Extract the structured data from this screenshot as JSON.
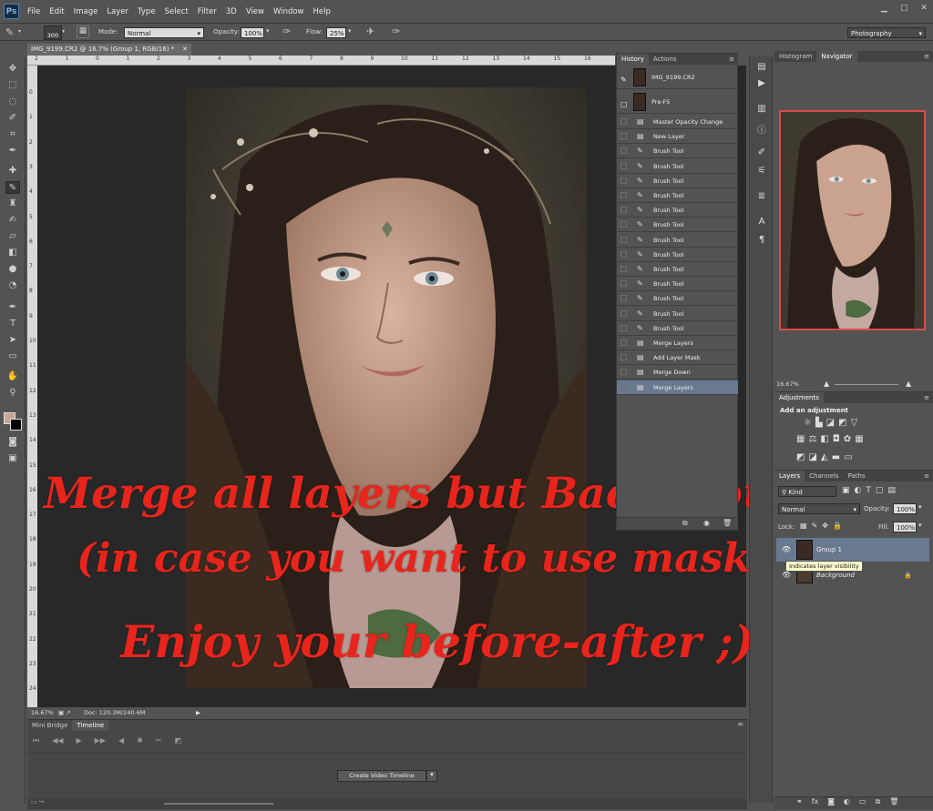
{
  "app": {
    "logo": "Ps"
  },
  "menu": [
    "File",
    "Edit",
    "Image",
    "Layer",
    "Type",
    "Select",
    "Filter",
    "3D",
    "View",
    "Window",
    "Help"
  ],
  "options": {
    "brush_size": "300",
    "mode_label": "Mode:",
    "mode_value": "Normal",
    "opacity_label": "Opacity:",
    "opacity_value": "100%",
    "flow_label": "Flow:",
    "flow_value": "25%",
    "workspace": "Photography"
  },
  "document": {
    "tab_title": "IMG_9199.CR2 @ 16.7% (Group 1, RGB/16) *",
    "ruler_numbers": [
      "2",
      "1",
      "0",
      "1",
      "2",
      "3",
      "4",
      "5",
      "6",
      "7",
      "8",
      "9",
      "10",
      "11",
      "12",
      "13",
      "14",
      "15",
      "16"
    ],
    "ruler_left_numbers": [
      "0",
      "1",
      "2",
      "3",
      "4",
      "5",
      "6",
      "7",
      "8",
      "9",
      "10",
      "11",
      "12",
      "13",
      "14",
      "15",
      "16",
      "17",
      "18",
      "19",
      "20",
      "21",
      "22",
      "23",
      "24",
      "25"
    ]
  },
  "status": {
    "zoom": "16.67%",
    "doc": "Doc: 120.3M/240.6M"
  },
  "overlay": {
    "line1": "Merge all layers but Background",
    "line2": "(in case you want to use mask)",
    "line3": "Enjoy your before-after ;)"
  },
  "timeline": {
    "tabs": [
      "Mini Bridge",
      "Timeline"
    ],
    "create_button": "Create Video Timeline"
  },
  "history": {
    "tabs": [
      "History",
      "Actions"
    ],
    "snapshots": [
      {
        "label": "IMG_9199.CR2"
      },
      {
        "label": "Pre-FS"
      }
    ],
    "items": [
      {
        "label": "Master Opacity Change",
        "icon": "doc-icon"
      },
      {
        "label": "New Layer",
        "icon": "doc-icon"
      },
      {
        "label": "Brush Tool",
        "icon": "brush-icon"
      },
      {
        "label": "Brush Tool",
        "icon": "brush-icon"
      },
      {
        "label": "Brush Tool",
        "icon": "brush-icon"
      },
      {
        "label": "Brush Tool",
        "icon": "brush-icon"
      },
      {
        "label": "Brush Tool",
        "icon": "brush-icon"
      },
      {
        "label": "Brush Tool",
        "icon": "brush-icon"
      },
      {
        "label": "Brush Tool",
        "icon": "brush-icon"
      },
      {
        "label": "Brush Tool",
        "icon": "brush-icon"
      },
      {
        "label": "Brush Tool",
        "icon": "brush-icon"
      },
      {
        "label": "Brush Tool",
        "icon": "brush-icon"
      },
      {
        "label": "Brush Tool",
        "icon": "brush-icon"
      },
      {
        "label": "Brush Tool",
        "icon": "brush-icon"
      },
      {
        "label": "Brush Tool",
        "icon": "brush-icon"
      },
      {
        "label": "Merge Layers",
        "icon": "doc-icon"
      },
      {
        "label": "Add Layer Mask",
        "icon": "doc-icon"
      },
      {
        "label": "Merge Down",
        "icon": "doc-icon"
      },
      {
        "label": "Merge Layers",
        "icon": "doc-icon",
        "selected": true
      }
    ]
  },
  "navigator": {
    "tabs": [
      "Histogram",
      "Navigator"
    ],
    "zoom": "16.67%"
  },
  "adjustments": {
    "tab": "Adjustments",
    "heading": "Add an adjustment"
  },
  "layers": {
    "tabs": [
      "Layers",
      "Channels",
      "Paths"
    ],
    "kind": "Kind",
    "blend": "Normal",
    "opacity_label": "Opacity:",
    "opacity": "100%",
    "lock_label": "Lock:",
    "fill_label": "Fill:",
    "fill": "100%",
    "rows": [
      {
        "name": "Group 1",
        "selected": true
      },
      {
        "name": "Background",
        "locked": true
      }
    ],
    "tooltip": "Indicates layer visibility"
  },
  "colors": {
    "selection": "#687990",
    "overlay_text": "#e8251c",
    "nav_border": "#e04848"
  }
}
